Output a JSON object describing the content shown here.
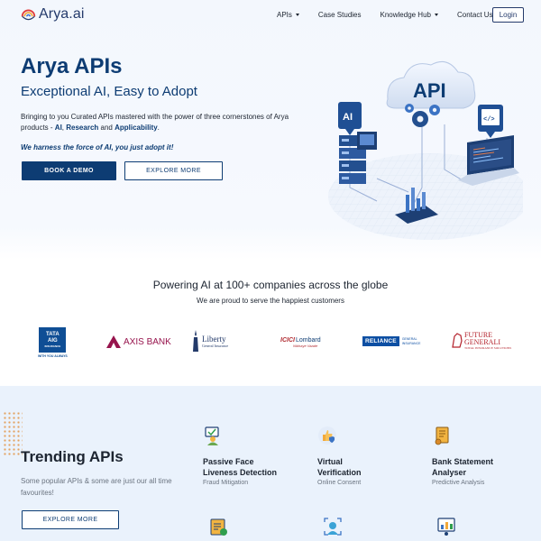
{
  "nav": {
    "logo_text": "Arya.ai",
    "links": [
      {
        "label": "APIs",
        "dropdown": true
      },
      {
        "label": "Case Studies",
        "dropdown": false
      },
      {
        "label": "Knowledge Hub",
        "dropdown": true
      },
      {
        "label": "Contact Us",
        "dropdown": false
      }
    ],
    "login_label": "Login"
  },
  "hero": {
    "title": "Arya APIs",
    "subtitle": "Exceptional AI, Easy to Adopt",
    "desc_prefix": "Bringing to you Curated APIs mastered with the power of three cornerstones of Arya products - ",
    "desc_ai": "AI",
    "desc_comma": ", ",
    "desc_research": "Research",
    "desc_and": " and ",
    "desc_applicability": "Applicability",
    "desc_end": ".",
    "emphasis": "We harness the force of AI, you just adopt it!",
    "book_demo_label": "BOOK A DEMO",
    "explore_label": "EXPLORE MORE",
    "art_api_label": "API",
    "art_ai_label": "AI",
    "art_code_label": "</>"
  },
  "partners": {
    "headline": "Powering AI at 100+ companies across the globe",
    "subline": "We are proud to serve the happiest customers",
    "logos": [
      {
        "name": "TATA AIG",
        "line1": "TATA",
        "line2": "AIG",
        "line3": "INSURANCE",
        "tag": "WITH YOU ALWAYS"
      },
      {
        "name": "AXIS BANK",
        "text": "AXIS BANK"
      },
      {
        "name": "Liberty",
        "line1": "Liberty",
        "line2": "General Insurance"
      },
      {
        "name": "ICICI Lombard",
        "line1": "ICICI",
        "line2": "Lombard",
        "line3": "Nibhaye Vaade"
      },
      {
        "name": "RELIANCE",
        "line1": "RELIANCE",
        "line2": "GENERAL",
        "line3": "INSURANCE"
      },
      {
        "name": "FUTURE GENERALI",
        "line1": "FUTURE",
        "line2": "GENERALI",
        "line3": "TOTAL INSURANCE SOLUTIONS"
      }
    ]
  },
  "trending": {
    "title": "Trending APIs",
    "desc": "Some popular APIs & some are just our all time favourites!",
    "explore_label": "EXPLORE MORE",
    "cards": [
      {
        "title_1": "Passive Face",
        "title_2": "Liveness Detection",
        "sub": "Fraud Mitigation",
        "icon": "face-check-icon"
      },
      {
        "title_1": "Virtual",
        "title_2": "Verification",
        "sub": "Online Consent",
        "icon": "thumbs-shield-icon"
      },
      {
        "title_1": "Bank Statement",
        "title_2": "Analyser",
        "sub": "Predictive Analysis",
        "icon": "document-scroll-icon"
      }
    ]
  },
  "colors": {
    "brand_navy": "#0d3c73",
    "trending_bg": "#eaf2fc",
    "accent_orange": "#e3a260"
  }
}
